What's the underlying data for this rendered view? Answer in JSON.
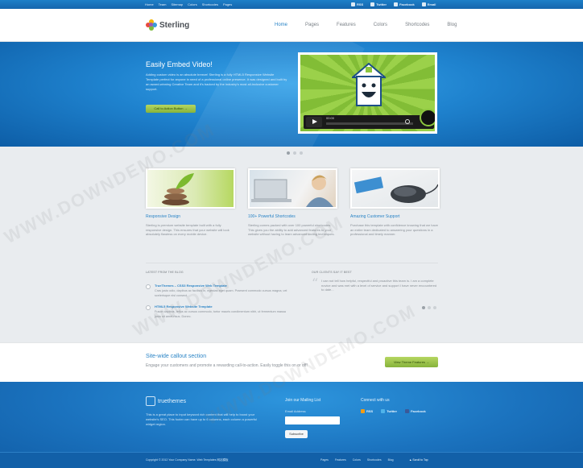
{
  "topbar": {
    "links": [
      "Home",
      "Team",
      "Sitemap",
      "Colors",
      "Shortcodes",
      "Pages"
    ],
    "social": [
      "RSS",
      "Twitter",
      "Facebook",
      "Email"
    ]
  },
  "header": {
    "logo_text": "Sterling",
    "nav": [
      "Home",
      "Pages",
      "Features",
      "Colors",
      "Shortcodes",
      "Blog"
    ]
  },
  "hero": {
    "title": "Easily Embed Video!",
    "body": "Adding custom video is an absolute breeze! Sterling is a fully HTML5 Responsive Website Template perfect for anyone in need of a professional online presence. It was designed and built by an award-winning Creative Team and it's backed by the industry's most all-inclusive customer support.",
    "button": "Call to Action Button →",
    "video_time": "00:00"
  },
  "features": [
    {
      "title": "Responsive Design",
      "text": "Sterling is premium website template built with a fully responsive design. This ensures that your website will look absolutely flawless on every mobile device."
    },
    {
      "title": "100+ Powerful Shortcodes",
      "text": "Sterling comes packed with over 100 powerful shortcodes. This gives you the ability to add advanced features to your website without having to learn advanced coding techniques."
    },
    {
      "title": "Amazing Customer Support",
      "text": "Purchase this template with confidence knowing that we have an entire team dedicated to answering your questions in a professional and timely manner."
    }
  ],
  "blog": {
    "title": "LATEST FROM THE BLOG",
    "posts": [
      {
        "title": "TrueThemes – CSS3 Responsive Web Template",
        "text": "Cras justo odio, dapibus ac facilisis in, egestas eget quam. Praesent commodo cursus magna, vel scelerisque nisl consect."
      },
      {
        "title": "HTML5 Responsive Website Template",
        "text": "Fusce dapibus, tellus ac cursus commodo, tortor mauris condimentum nibh, ut fermentum massa justo sit amet risus. Donec."
      }
    ]
  },
  "testimonials": {
    "title": "OUR CLIENTS SAY IT BEST",
    "quote": "I can not tell how helpful, respectful and proactive this team is. I am a complete novice and was met with a level of service and support I have never encountered to date..."
  },
  "callout": {
    "title": "Site-wide callout section",
    "text": "Engage your customers and promote a rewarding call-to-action. Easily toggle this on or off!",
    "button": "View Theme Features →"
  },
  "footer": {
    "logo": "truethemes",
    "about": "This is a great place to input keyword rich content that will help to boost your website's SEO. This footer can have up to 6 columns, each column a powerful widget region.",
    "mailing_title": "Join our Mailing List",
    "email_label": "Email Address",
    "subscribe": "Subscribe",
    "connect_title": "Connect with us",
    "social": [
      "RSS",
      "Twitter",
      "Facebook"
    ],
    "copyright": "Copyright © 2012 Your Company Name. Web Templates 网站模板",
    "nav": [
      "Pages",
      "Features",
      "Colors",
      "Shortcodes",
      "Blog"
    ],
    "scroll_top": "▲ Scroll to Top"
  },
  "watermark": "WWW.DOWNDEMO.COM"
}
